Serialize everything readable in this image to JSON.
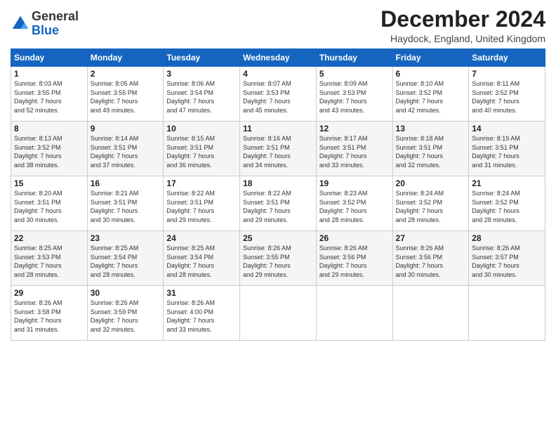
{
  "logo": {
    "line1": "General",
    "line2": "Blue"
  },
  "title": "December 2024",
  "subtitle": "Haydock, England, United Kingdom",
  "days_of_week": [
    "Sunday",
    "Monday",
    "Tuesday",
    "Wednesday",
    "Thursday",
    "Friday",
    "Saturday"
  ],
  "weeks": [
    [
      {
        "day": "1",
        "info": "Sunrise: 8:03 AM\nSunset: 3:55 PM\nDaylight: 7 hours\nand 52 minutes."
      },
      {
        "day": "2",
        "info": "Sunrise: 8:05 AM\nSunset: 3:55 PM\nDaylight: 7 hours\nand 49 minutes."
      },
      {
        "day": "3",
        "info": "Sunrise: 8:06 AM\nSunset: 3:54 PM\nDaylight: 7 hours\nand 47 minutes."
      },
      {
        "day": "4",
        "info": "Sunrise: 8:07 AM\nSunset: 3:53 PM\nDaylight: 7 hours\nand 45 minutes."
      },
      {
        "day": "5",
        "info": "Sunrise: 8:09 AM\nSunset: 3:53 PM\nDaylight: 7 hours\nand 43 minutes."
      },
      {
        "day": "6",
        "info": "Sunrise: 8:10 AM\nSunset: 3:52 PM\nDaylight: 7 hours\nand 42 minutes."
      },
      {
        "day": "7",
        "info": "Sunrise: 8:11 AM\nSunset: 3:52 PM\nDaylight: 7 hours\nand 40 minutes."
      }
    ],
    [
      {
        "day": "8",
        "info": "Sunrise: 8:13 AM\nSunset: 3:52 PM\nDaylight: 7 hours\nand 38 minutes."
      },
      {
        "day": "9",
        "info": "Sunrise: 8:14 AM\nSunset: 3:51 PM\nDaylight: 7 hours\nand 37 minutes."
      },
      {
        "day": "10",
        "info": "Sunrise: 8:15 AM\nSunset: 3:51 PM\nDaylight: 7 hours\nand 36 minutes."
      },
      {
        "day": "11",
        "info": "Sunrise: 8:16 AM\nSunset: 3:51 PM\nDaylight: 7 hours\nand 34 minutes."
      },
      {
        "day": "12",
        "info": "Sunrise: 8:17 AM\nSunset: 3:51 PM\nDaylight: 7 hours\nand 33 minutes."
      },
      {
        "day": "13",
        "info": "Sunrise: 8:18 AM\nSunset: 3:51 PM\nDaylight: 7 hours\nand 32 minutes."
      },
      {
        "day": "14",
        "info": "Sunrise: 8:19 AM\nSunset: 3:51 PM\nDaylight: 7 hours\nand 31 minutes."
      }
    ],
    [
      {
        "day": "15",
        "info": "Sunrise: 8:20 AM\nSunset: 3:51 PM\nDaylight: 7 hours\nand 30 minutes."
      },
      {
        "day": "16",
        "info": "Sunrise: 8:21 AM\nSunset: 3:51 PM\nDaylight: 7 hours\nand 30 minutes."
      },
      {
        "day": "17",
        "info": "Sunrise: 8:22 AM\nSunset: 3:51 PM\nDaylight: 7 hours\nand 29 minutes."
      },
      {
        "day": "18",
        "info": "Sunrise: 8:22 AM\nSunset: 3:51 PM\nDaylight: 7 hours\nand 29 minutes."
      },
      {
        "day": "19",
        "info": "Sunrise: 8:23 AM\nSunset: 3:52 PM\nDaylight: 7 hours\nand 28 minutes."
      },
      {
        "day": "20",
        "info": "Sunrise: 8:24 AM\nSunset: 3:52 PM\nDaylight: 7 hours\nand 28 minutes."
      },
      {
        "day": "21",
        "info": "Sunrise: 8:24 AM\nSunset: 3:52 PM\nDaylight: 7 hours\nand 28 minutes."
      }
    ],
    [
      {
        "day": "22",
        "info": "Sunrise: 8:25 AM\nSunset: 3:53 PM\nDaylight: 7 hours\nand 28 minutes."
      },
      {
        "day": "23",
        "info": "Sunrise: 8:25 AM\nSunset: 3:54 PM\nDaylight: 7 hours\nand 28 minutes."
      },
      {
        "day": "24",
        "info": "Sunrise: 8:25 AM\nSunset: 3:54 PM\nDaylight: 7 hours\nand 28 minutes."
      },
      {
        "day": "25",
        "info": "Sunrise: 8:26 AM\nSunset: 3:55 PM\nDaylight: 7 hours\nand 29 minutes."
      },
      {
        "day": "26",
        "info": "Sunrise: 8:26 AM\nSunset: 3:56 PM\nDaylight: 7 hours\nand 29 minutes."
      },
      {
        "day": "27",
        "info": "Sunrise: 8:26 AM\nSunset: 3:56 PM\nDaylight: 7 hours\nand 30 minutes."
      },
      {
        "day": "28",
        "info": "Sunrise: 8:26 AM\nSunset: 3:57 PM\nDaylight: 7 hours\nand 30 minutes."
      }
    ],
    [
      {
        "day": "29",
        "info": "Sunrise: 8:26 AM\nSunset: 3:58 PM\nDaylight: 7 hours\nand 31 minutes."
      },
      {
        "day": "30",
        "info": "Sunrise: 8:26 AM\nSunset: 3:59 PM\nDaylight: 7 hours\nand 32 minutes."
      },
      {
        "day": "31",
        "info": "Sunrise: 8:26 AM\nSunset: 4:00 PM\nDaylight: 7 hours\nand 33 minutes."
      },
      null,
      null,
      null,
      null
    ]
  ]
}
